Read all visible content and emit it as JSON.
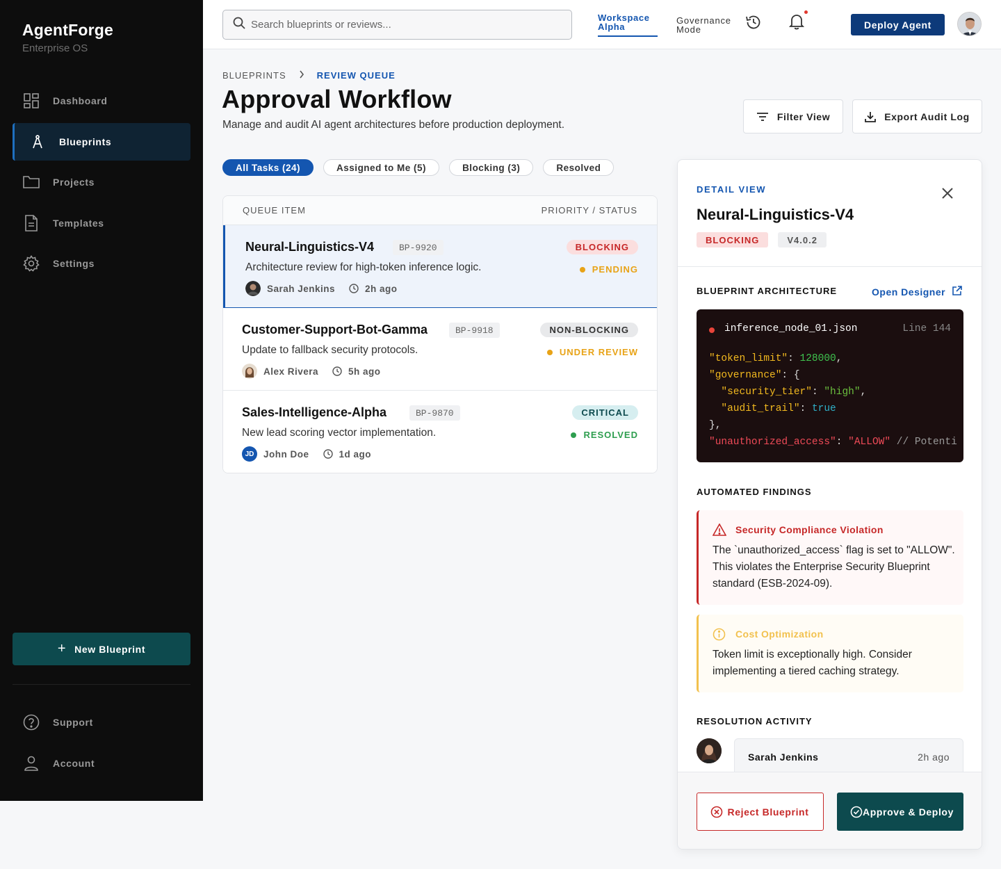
{
  "sidebar": {
    "brand": "AgentForge",
    "brand_sub": "Enterprise OS",
    "items": [
      {
        "label": "Dashboard",
        "icon": "dashboard-icon"
      },
      {
        "label": "Blueprints",
        "icon": "compass-icon",
        "active": true
      },
      {
        "label": "Projects",
        "icon": "folder-icon"
      },
      {
        "label": "Templates",
        "icon": "document-icon"
      },
      {
        "label": "Settings",
        "icon": "gear-icon"
      }
    ],
    "new_button": "New Blueprint",
    "bottom": [
      {
        "label": "Support",
        "icon": "help-icon"
      },
      {
        "label": "Account",
        "icon": "user-icon"
      }
    ]
  },
  "topbar": {
    "search_placeholder": "Search blueprints or reviews...",
    "workspace": "Workspace Alpha",
    "governance": "Governance Mode",
    "deploy": "Deploy Agent",
    "notification_color": "#e0392f"
  },
  "main": {
    "breadcrumb": [
      "BLUEPRINTS",
      "REVIEW QUEUE"
    ],
    "title": "Approval Workflow",
    "subtitle": "Manage and audit AI agent architectures before production deployment.",
    "filter_btn": "Filter View",
    "export_btn": "Export Audit Log",
    "chips": [
      "All Tasks (24)",
      "Assigned to Me (5)",
      "Blocking (3)",
      "Resolved"
    ],
    "queue_head": {
      "left": "QUEUE ITEM",
      "right": "PRIORITY / STATUS"
    },
    "rows": [
      {
        "name": "Neural-Linguistics-V4",
        "code": "BP-9920",
        "desc": "Architecture review for high-token inference logic.",
        "user": "Sarah Jenkins",
        "time": "2h ago",
        "badge": "BLOCKING",
        "badge_bg": "#fbdede",
        "badge_fg": "#c62828",
        "status": "PENDING",
        "status_color": "#e8a317"
      },
      {
        "name": "Customer-Support-Bot-Gamma",
        "code": "BP-9918",
        "desc": "Update to fallback security protocols.",
        "user": "Alex Rivera",
        "time": "5h ago",
        "badge": "NON-BLOCKING",
        "badge_bg": "#e8e9eb",
        "badge_fg": "#333333",
        "status": "UNDER REVIEW",
        "status_color": "#e8a317"
      },
      {
        "name": "Sales-Intelligence-Alpha",
        "code": "BP-9870",
        "desc": "New lead scoring vector implementation.",
        "user": "John Doe",
        "user_initials": "JD",
        "time": "1d ago",
        "badge": "CRITICAL",
        "badge_bg": "#d6eef0",
        "badge_fg": "#0d4a4e",
        "status": "RESOLVED",
        "status_color": "#2e9e4f"
      }
    ]
  },
  "detail": {
    "label": "DETAIL VIEW",
    "title": "Neural-Linguistics-V4",
    "badge": "BLOCKING",
    "version": "V4.0.2",
    "arch_title": "BLUEPRINT ARCHITECTURE",
    "open_designer": "Open Designer",
    "code": {
      "file": "inference_node_01.json",
      "line": "Line 144",
      "lines": [
        {
          "parts": [
            {
              "t": "\"token_limit\"",
              "c": "k"
            },
            {
              "t": ": ",
              "c": ""
            },
            {
              "t": "128000",
              "c": "n"
            },
            {
              "t": ",",
              "c": ""
            }
          ]
        },
        {
          "parts": [
            {
              "t": "\"governance\"",
              "c": "k"
            },
            {
              "t": ": {",
              "c": ""
            }
          ]
        },
        {
          "parts": [
            {
              "t": "  \"security_tier\"",
              "c": "k"
            },
            {
              "t": ": ",
              "c": ""
            },
            {
              "t": "\"high\"",
              "c": "s"
            },
            {
              "t": ",",
              "c": ""
            }
          ]
        },
        {
          "parts": [
            {
              "t": "  \"audit_trail\"",
              "c": "k"
            },
            {
              "t": ": ",
              "c": ""
            },
            {
              "t": "true",
              "c": "b"
            }
          ]
        },
        {
          "parts": [
            {
              "t": "},",
              "c": ""
            }
          ]
        },
        {
          "parts": [
            {
              "t": "\"unauthorized_access\"",
              "c": "r"
            },
            {
              "t": ": ",
              "c": ""
            },
            {
              "t": "\"ALLOW\"",
              "c": "r"
            },
            {
              "t": " // Potenti",
              "c": "c"
            }
          ]
        }
      ]
    },
    "findings_title": "AUTOMATED FINDINGS",
    "findings": [
      {
        "title": "Security Compliance Violation",
        "body": "The `unauthorized_access` flag is set to \"ALLOW\". This violates the Enterprise Security Blueprint standard (ESB-2024-09).",
        "color": "#c62828"
      },
      {
        "title": "Cost Optimization",
        "body": "Token limit is exceptionally high. Consider implementing a tiered caching strategy.",
        "color": "#f2c14e"
      }
    ],
    "activity_title": "RESOLUTION ACTIVITY",
    "activity": {
      "user": "Sarah Jenkins",
      "time": "2h ago"
    },
    "reject": "Reject Blueprint",
    "approve": "Approve & Deploy"
  }
}
